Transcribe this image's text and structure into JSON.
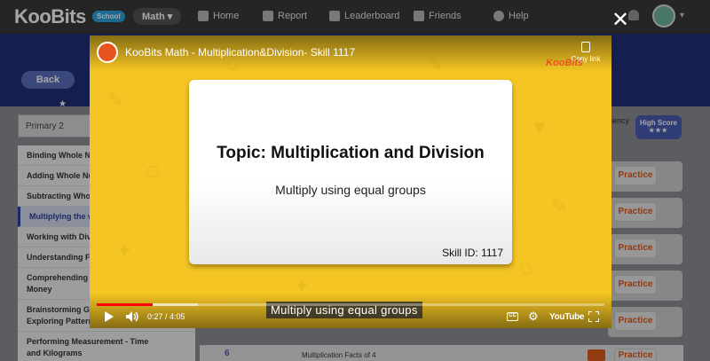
{
  "nav": {
    "logo": "KooBits",
    "school_badge": "School",
    "subject": "Math",
    "items": [
      {
        "label": "Home",
        "icon": "home-icon"
      },
      {
        "label": "Report",
        "icon": "bar-chart-icon"
      },
      {
        "label": "Leaderboard",
        "icon": "leaderboard-icon"
      },
      {
        "label": "Friends",
        "icon": "friends-icon"
      },
      {
        "label": "Help",
        "icon": "help-icon"
      }
    ]
  },
  "back_label": "Back",
  "level": "Primary 2",
  "sidebar": [
    "Binding Whole N",
    "Adding Whole Nu",
    "Subtracting Who",
    "Multiplying the w",
    "Working with Div",
    "Understanding F",
    "Comprehending",
    "Money",
    "Brainstorming Ge",
    "Exploring Pattern",
    "Performing Measurement - Time",
    "and Kilograms"
  ],
  "tabs": {
    "proficiency": "iency",
    "high_score": "High Score",
    "stars": "★★★"
  },
  "practice_label": "Practice",
  "bottom_row": {
    "number": "6",
    "label": "Multiplication Facts of 4"
  },
  "video": {
    "title": "KooBits Math - Multiplication&Division- Skill 1117",
    "copy_link": "Copy link",
    "watermark": "KooBits",
    "slide_topic": "Topic: Multiplication and Division",
    "slide_subtitle": "Multiply using equal groups",
    "skill_id": "Skill ID: 1117",
    "caption": "Multiply using equal groups",
    "time": "0:27 / 4:05",
    "progress_fraction": 0.11,
    "buffered_fraction": 0.2,
    "yt_brand": "YouTube",
    "cc": "CC"
  },
  "colors": {
    "accent": "#f4c523",
    "brand_orange": "#e8541f",
    "progress": "#ff0000"
  }
}
